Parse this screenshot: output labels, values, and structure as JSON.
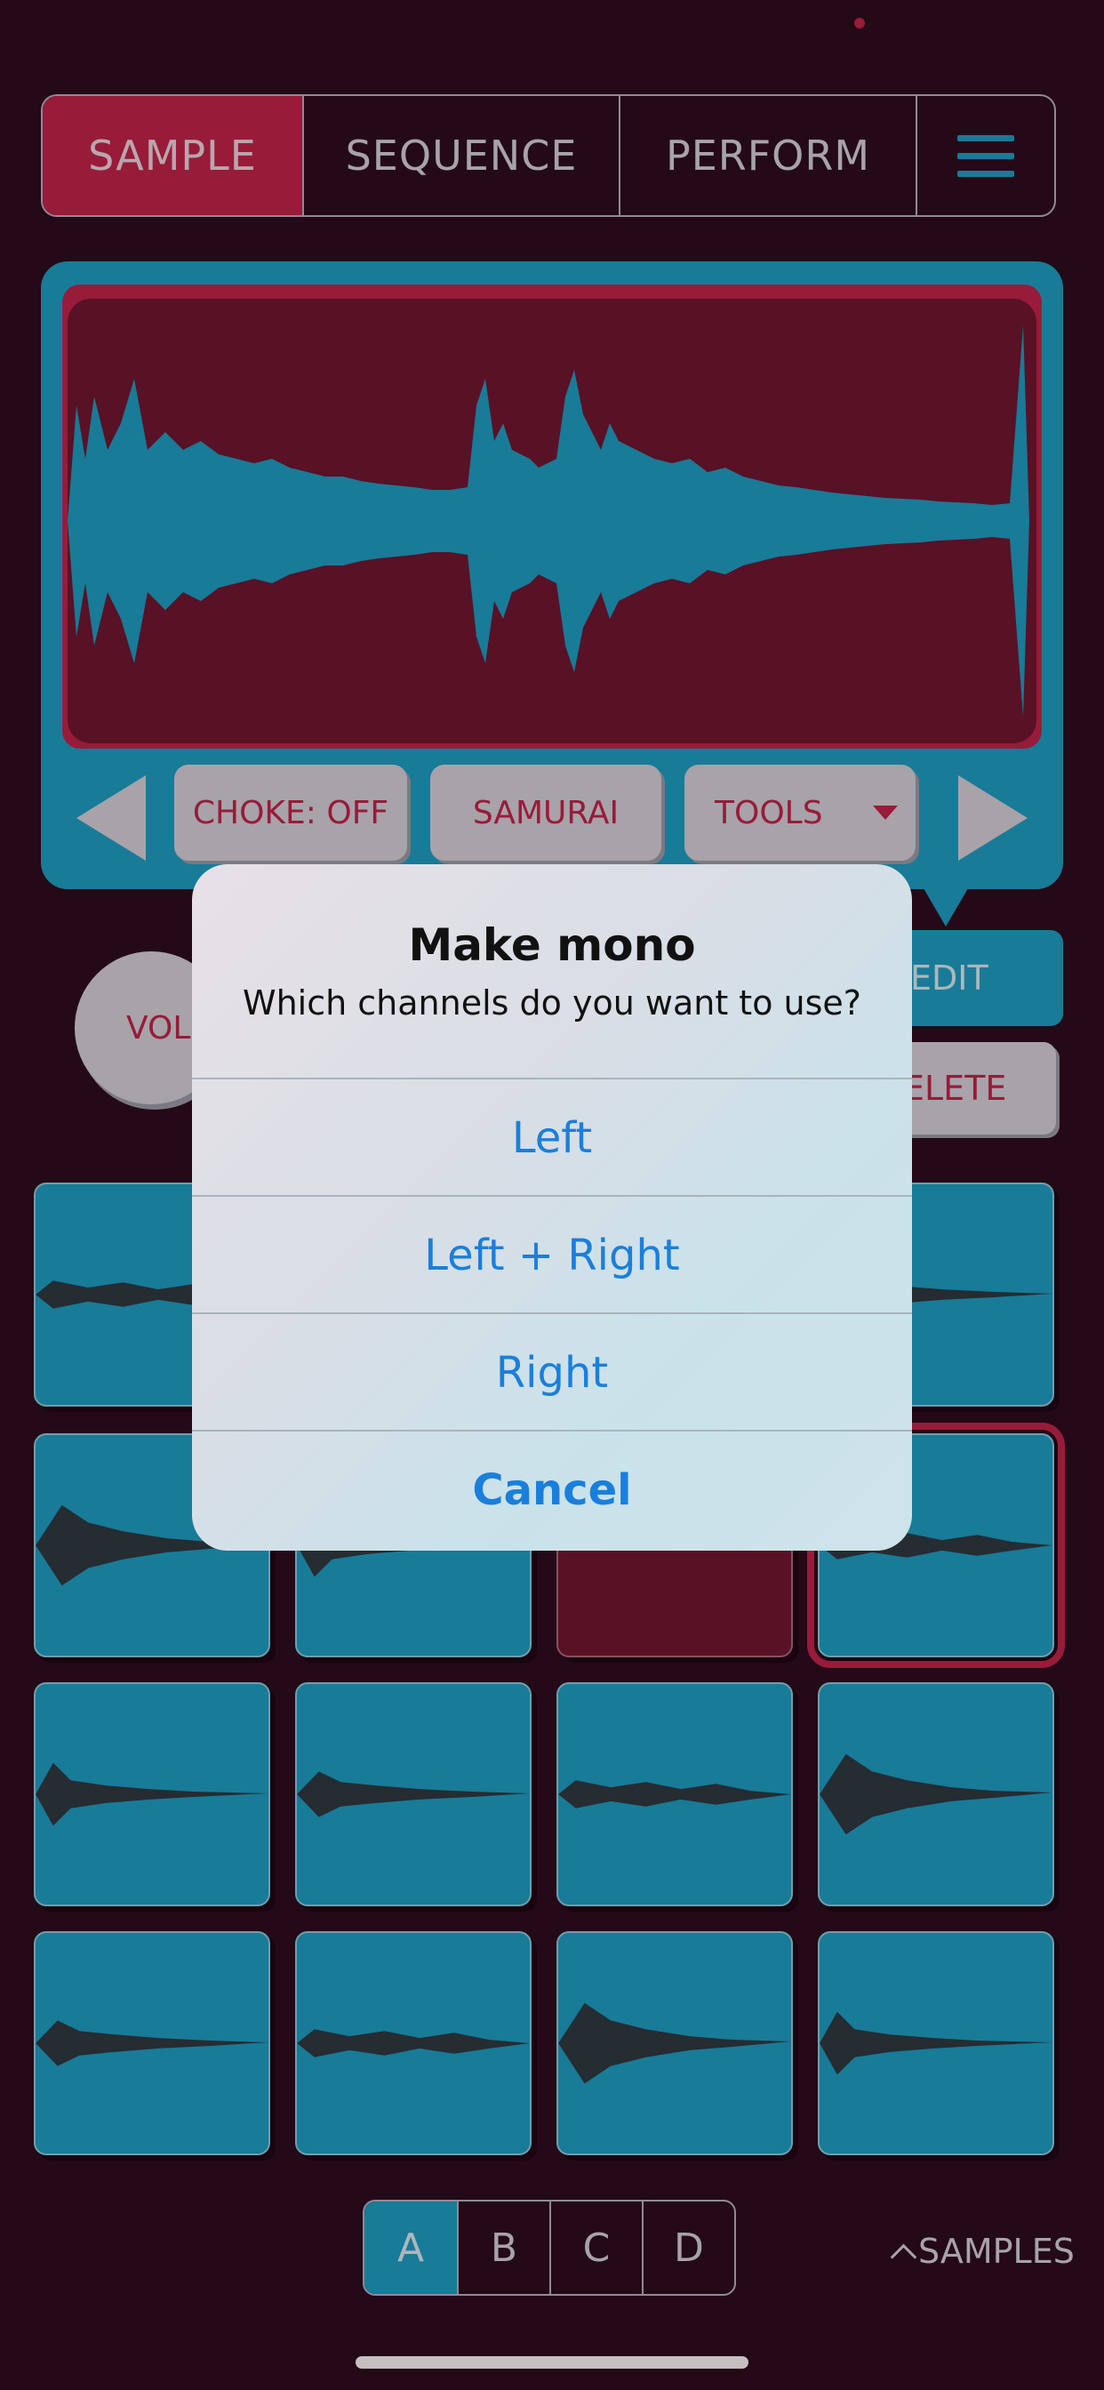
{
  "tabs": {
    "sample": "SAMPLE",
    "sequence": "SEQUENCE",
    "perform": "PERFORM"
  },
  "controls": {
    "choke": "CHOKE: OFF",
    "samurai": "SAMURAI",
    "tools": "TOOLS"
  },
  "side": {
    "vol": "VOL",
    "edit": "EDIT",
    "delete": "ELETE"
  },
  "pads": {
    "selected_index": 7,
    "empty_index": 6
  },
  "bank": {
    "options": [
      "A",
      "B",
      "C",
      "D"
    ],
    "selected": "A"
  },
  "samples_link": "SAMPLES",
  "dialog": {
    "title": "Make mono",
    "message": "Which channels do you want to use?",
    "actions": [
      "Left",
      "Left + Right",
      "Right"
    ],
    "cancel": "Cancel"
  },
  "colors": {
    "background": "#2a0b1b",
    "accent_red": "#c5234a",
    "accent_blue": "#1aa3c7",
    "ios_blue": "#1a7fdc"
  }
}
